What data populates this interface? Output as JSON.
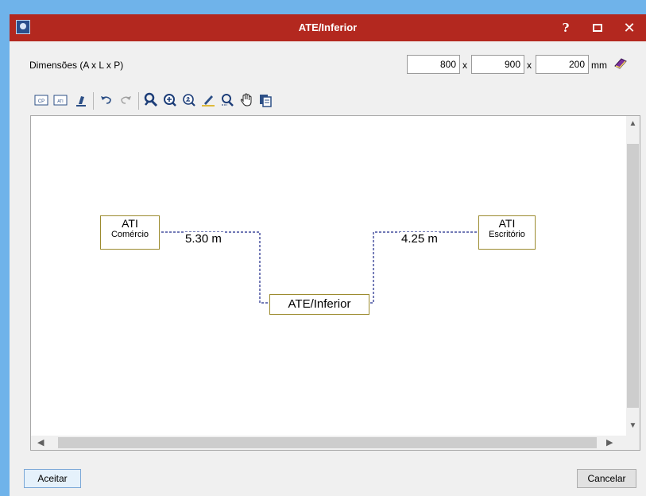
{
  "window": {
    "title": "ATE/Inferior",
    "help_label": "?",
    "close_label": "✕"
  },
  "dimensions": {
    "label": "Dimensões (A x L x P)",
    "a": "800",
    "l": "900",
    "p": "200",
    "sep": "x",
    "unit": "mm"
  },
  "toolbar": {
    "icons": [
      "cp-icon",
      "ati-icon",
      "edit-icon",
      "undo-icon",
      "redo-icon",
      "zoom-extents-icon",
      "zoom-in-icon",
      "zoom-x2-icon",
      "pencil-icon",
      "zoom-window-icon",
      "pan-hand-icon",
      "copy-icon"
    ],
    "cp_label": "CP",
    "ati_label": "ATI"
  },
  "diagram": {
    "left_node": {
      "line1": "ATI",
      "line2": "Comércio"
    },
    "right_node": {
      "line1": "ATI",
      "line2": "Escritório"
    },
    "center_node": "ATE/Inferior",
    "left_distance": "5.30 m",
    "right_distance": "4.25 m",
    "line_color": "#1f2a8a",
    "node_border_color": "#9c8b2f"
  },
  "buttons": {
    "accept": "Aceitar",
    "cancel": "Cancelar"
  },
  "colors": {
    "titlebar": "#b3281f",
    "window_border": "#6fb3ea"
  }
}
